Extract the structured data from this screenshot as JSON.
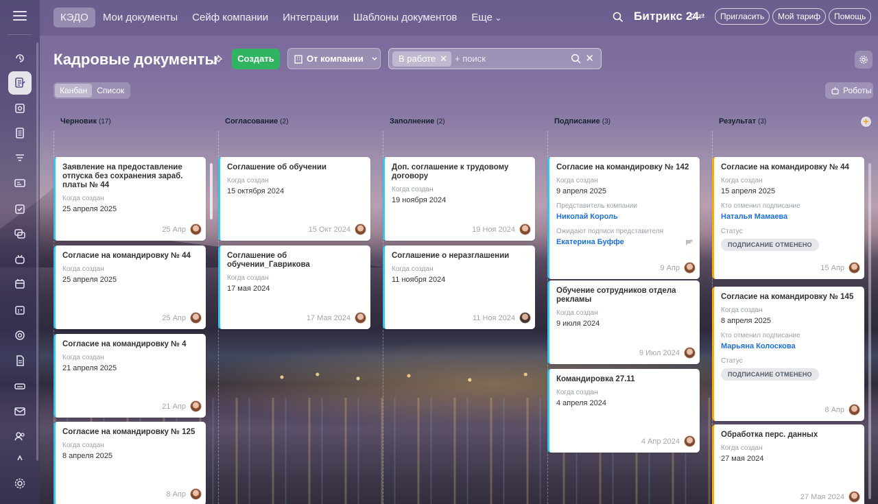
{
  "topnav": {
    "items": [
      "КЭДО",
      "Мои документы",
      "Сейф компании",
      "Интеграции",
      "Шаблоны документов",
      "Еще"
    ],
    "brand": "Битрикс 24",
    "brand_mark": "⊙ ⇄",
    "invite": "Пригласить",
    "tariff": "Мой тариф",
    "help": "Помощь"
  },
  "toolbar": {
    "title": "Кадровые документы",
    "create": "Создать",
    "company": "От компании",
    "filter_chip": "В работе",
    "search_placeholder": "+ поиск",
    "view_kanban": "Канбан",
    "view_list": "Список",
    "robots": "Роботы"
  },
  "columns": [
    {
      "name": "Черновик",
      "count": "(17)",
      "color": "#2fc6f6",
      "cards": [
        {
          "title": "Заявление на предоставление отпуска без сохранения зараб. платы № 44",
          "fields": [
            {
              "label": "Когда создан",
              "value": "25 апреля 2025"
            }
          ],
          "date": "25 Апр"
        },
        {
          "title": "Согласие на командировку № 44",
          "fields": [
            {
              "label": "Когда создан",
              "value": "25 апреля 2025"
            }
          ],
          "date": "25 Апр"
        },
        {
          "title": "Согласие на командировку № 4",
          "fields": [
            {
              "label": "Когда создан",
              "value": "21 апреля 2025"
            }
          ],
          "date": "21 Апр"
        },
        {
          "title": "Согласие на командировку № 125",
          "fields": [
            {
              "label": "Когда создан",
              "value": "8 апреля 2025"
            }
          ],
          "date": "8 Апр"
        }
      ]
    },
    {
      "name": "Согласование",
      "count": "(2)",
      "color": "#2fc6f6",
      "cards": [
        {
          "title": "Соглашение об обучении",
          "fields": [
            {
              "label": "Когда создан",
              "value": "15 октября 2024"
            }
          ],
          "date": "15 Окт 2024"
        },
        {
          "title": "Соглашение об обучении_Гаврикова",
          "fields": [
            {
              "label": "Когда создан",
              "value": "17 мая 2024"
            }
          ],
          "date": "17 Мая 2024"
        }
      ]
    },
    {
      "name": "Заполнение",
      "count": "(2)",
      "color": "#2fc6f6",
      "cards": [
        {
          "title": "Доп. соглашение к трудовому договору",
          "fields": [
            {
              "label": "Когда создан",
              "value": "19 ноября 2024"
            }
          ],
          "date": "19 Ноя 2024"
        },
        {
          "title": "Соглашение о неразглашении",
          "fields": [
            {
              "label": "Когда создан",
              "value": "11 ноября 2024"
            }
          ],
          "date": "11 Ноя 2024"
        }
      ]
    },
    {
      "name": "Подписание",
      "count": "(3)",
      "color": "#2fc6f6",
      "cards": [
        {
          "title": "Согласие на командировку № 142",
          "fields": [
            {
              "label": "Когда создан",
              "value": "9 апреля 2025"
            },
            {
              "label": "Представитель компании",
              "link": "Николай Король"
            },
            {
              "label": "Ожидают подписи представителя",
              "link": "Екатерина Буффе"
            }
          ],
          "date": "9 Апр"
        },
        {
          "title": "Обучение сотрудников отдела рекламы",
          "fields": [
            {
              "label": "Когда создан",
              "value": "9 июля 2024"
            }
          ],
          "date": "9 Июл 2024"
        },
        {
          "title": "Командировка 27.11",
          "fields": [
            {
              "label": "Когда создан",
              "value": "4 апреля 2024"
            }
          ],
          "date": "4 Апр 2024"
        }
      ]
    },
    {
      "name": "Результат",
      "count": "(3)",
      "color": "#ffa900",
      "cards": [
        {
          "title": "Согласие на командировку № 44",
          "fields": [
            {
              "label": "Когда создан",
              "value": "15 апреля 2025"
            },
            {
              "label": "Кто отменил подписание",
              "link": "Наталья Мамаева"
            },
            {
              "label": "Статус",
              "badge": "ПОДПИСАНИЕ ОТМЕНЕНО"
            }
          ],
          "date": "15 Апр"
        },
        {
          "title": "Согласие на командировку № 145",
          "fields": [
            {
              "label": "Когда создан",
              "value": "8 апреля 2025"
            },
            {
              "label": "Кто отменил подписание",
              "link": "Марьяна Колоскова"
            },
            {
              "label": "Статус",
              "badge": "ПОДПИСАНИЕ ОТМЕНЕНО"
            }
          ],
          "date": "8 Апр"
        },
        {
          "title": "Обработка перс. данных",
          "fields": [
            {
              "label": "Когда создан",
              "value": "27 мая 2024"
            }
          ],
          "date": "27 Мая 2024"
        }
      ]
    }
  ]
}
